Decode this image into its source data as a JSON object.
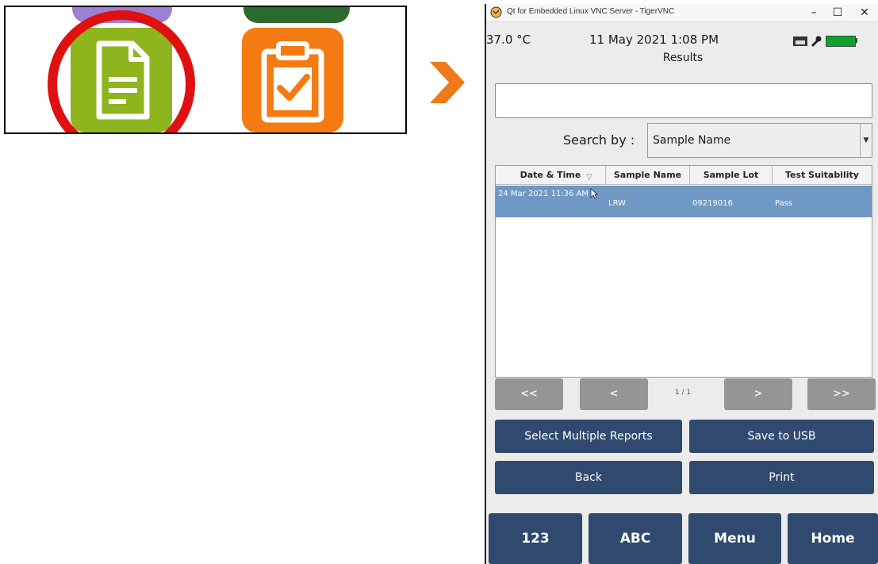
{
  "window": {
    "title": "Qt for Embedded Linux VNC Server - TigerVNC",
    "minimize": "–",
    "maximize": "☐",
    "close": "✕"
  },
  "status": {
    "temperature": "37.0 °C",
    "datetime": "11 May 2021 1:08 PM",
    "battery_color": "#0da32b"
  },
  "page": {
    "title": "Results"
  },
  "search": {
    "input_value": "",
    "by_label": "Search by :",
    "by_value": "Sample Name"
  },
  "table": {
    "columns": [
      "Date & Time",
      "Sample Name",
      "Sample Lot",
      "Test Suitability"
    ],
    "rows": [
      {
        "date": "24 Mar 2021 11:36 AM",
        "sample": "LRW",
        "lot": "09219016",
        "suitability": "Pass"
      }
    ]
  },
  "pagination": {
    "first": "<<",
    "prev": "<",
    "indicator": "1 / 1",
    "next": ">",
    "last": ">>"
  },
  "actions": {
    "select_multiple": "Select Multiple Reports",
    "save_usb": "Save to USB",
    "back": "Back",
    "print": "Print"
  },
  "bottom_nav": {
    "numeric": "123",
    "alpha": "ABC",
    "menu": "Menu",
    "home": "Home"
  },
  "colors": {
    "highlight_ring": "#e01010",
    "arrow": "#f07a1a",
    "doc_tile": "#8eb41e",
    "clipboard_tile": "#f47b12",
    "navy_button": "#2f4a6e",
    "selected_row": "#6f98c4"
  }
}
